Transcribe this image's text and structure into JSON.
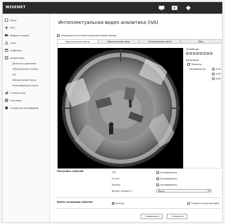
{
  "topbar": {
    "logo": "WISENET",
    "icons": [
      "monitor-icon",
      "playback-icon",
      "settings-gear-icon"
    ]
  },
  "sidebar": {
    "items": [
      {
        "label": "Базо",
        "icon": "home-icon"
      },
      {
        "label": "PTZ",
        "icon": "ptz-icon"
      },
      {
        "label": "Видео и аудио",
        "icon": "video-audio-icon"
      },
      {
        "label": "Сеть",
        "icon": "network-icon"
      },
      {
        "label": "Событие",
        "icon": "event-icon"
      },
      {
        "label": "Аналитика",
        "icon": "analytics-icon"
      },
      {
        "label": "Статистика",
        "icon": "statistics-icon"
      },
      {
        "label": "Система",
        "icon": "system-icon"
      },
      {
        "label": "Открытая платформа",
        "icon": "open-platform-icon"
      }
    ],
    "sub_items": [
      "Детектор движения",
      "Обнаружение взлома",
      "IVA",
      "Обнаружение звука",
      "Классификация звука"
    ]
  },
  "main": {
    "title": "Интеллектуальная видео аналитика (IVA)",
    "enable_label": "Разрешить интеллектуальный анализ видео",
    "tabs": [
      "Виртуальная линия",
      "Виртуальная зона",
      "Исключенная зона",
      "Общ."
    ],
    "active_tab": 0,
    "right_panel": {
      "line_label": "Линейный",
      "line_numbers": [
        "1",
        "2",
        "3",
        "4",
        "5",
        "6",
        "7",
        "8"
      ],
      "category_label": "Категория",
      "cross_label": "Переход",
      "direction_label": "Направление",
      "directions": [
        "A⇒B",
        "A⇐B",
        "A⇔B"
      ]
    }
  },
  "event_settings": {
    "label": "Настройка событий",
    "rows": [
      {
        "name": "FTP",
        "value": "Активировать"
      },
      {
        "name": "E-mail",
        "value": "Активировать"
      },
      {
        "name": "Запись",
        "value": "Активировать"
      },
      {
        "name": "Выход тревоги 1",
        "value": "Выкл"
      }
    ]
  },
  "activation_time": {
    "label": "Время активации события:",
    "option_always": "Всегда",
    "option_schedule": "Только по расписанию"
  },
  "buttons": {
    "apply": "Применить",
    "cancel": "Отменить"
  },
  "colors": {
    "topbar": "#2a2a2a",
    "brand_red": "#e0312f"
  }
}
